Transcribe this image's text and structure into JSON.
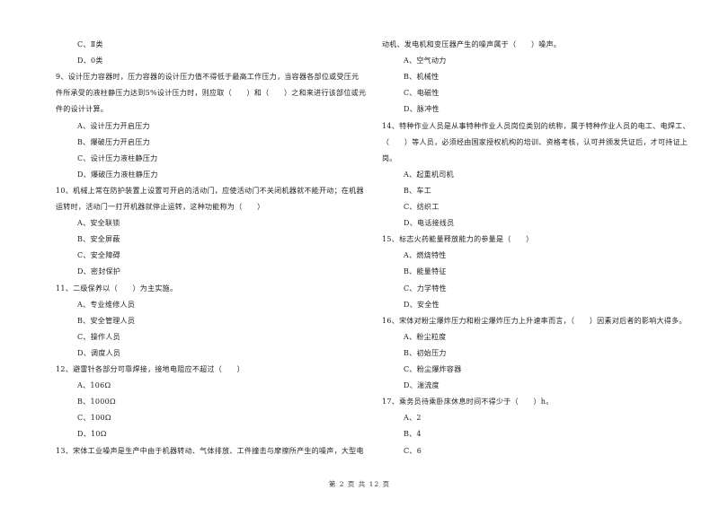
{
  "left_column": {
    "lines": [
      {
        "kind": "option",
        "text": "C、Ⅱ类"
      },
      {
        "kind": "option",
        "text": "D、0类"
      },
      {
        "kind": "question",
        "text": "9、设计压力容器时，压力容器的设计压力值不得低于最高工作压力，当容器各部位或受压元"
      },
      {
        "kind": "question",
        "text": "件所承受的液柱静压力达到5%设计压力时，则应取（　　）和（　　）之和来进行该部位或元"
      },
      {
        "kind": "question",
        "text": "件的设计计算。"
      },
      {
        "kind": "option",
        "text": "A、设计压力开启压力"
      },
      {
        "kind": "option",
        "text": "B、爆破压力开启压力"
      },
      {
        "kind": "option",
        "text": "C、设计压力液柱静压力"
      },
      {
        "kind": "option",
        "text": "D、爆破压力液柱静压力"
      },
      {
        "kind": "question",
        "text": "10、机械上常在防护装置上设置可开启的活动门，应使活动门不关闭机器就不能开动；在机器"
      },
      {
        "kind": "question",
        "text": "运转时，活动门一打开机器就停止运转，这种功能称为（　　）"
      },
      {
        "kind": "option",
        "text": "A、安全联锁"
      },
      {
        "kind": "option",
        "text": "B、安全屏蔽"
      },
      {
        "kind": "option",
        "text": "C、安全障碍"
      },
      {
        "kind": "option",
        "text": "D、密封保护"
      },
      {
        "kind": "question",
        "text": "11、二级保养以（　　）为主实施。"
      },
      {
        "kind": "option",
        "text": "A、专业维修人员"
      },
      {
        "kind": "option",
        "text": "B、安全管理人员"
      },
      {
        "kind": "option",
        "text": "C、操作人员"
      },
      {
        "kind": "option",
        "text": "D、调度人员"
      },
      {
        "kind": "question",
        "text": "12、避雷针各部分可靠焊接，接地电阻应不超过（　　）"
      },
      {
        "kind": "option",
        "text": "A、106Ω"
      },
      {
        "kind": "option",
        "text": "B、1000Ω"
      },
      {
        "kind": "option",
        "text": "C、100Ω"
      },
      {
        "kind": "option",
        "text": "D、10Ω"
      },
      {
        "kind": "question",
        "text": "13、宋体工业噪声是生产中由于机器转动、气体排放、工件撞击与摩擦所产生的噪声，大型电"
      }
    ]
  },
  "right_column": {
    "lines": [
      {
        "kind": "question",
        "text": "动机、发电机和变压器产生的噪声属于（　　）噪声。"
      },
      {
        "kind": "option",
        "text": "A、空气动力"
      },
      {
        "kind": "option",
        "text": "B、机械性"
      },
      {
        "kind": "option",
        "text": "C、电磁性"
      },
      {
        "kind": "option",
        "text": "D、脉冲性"
      },
      {
        "kind": "question",
        "text": "14、特种作业人员是从事特种作业人员岗位类别的统称，属于特种作业人员的电工、电焊工、"
      },
      {
        "kind": "question",
        "text": "（　　）等人员，必须经由国家授权机构的培训、资格考核，认可并颁发凭证后，才可持证上"
      },
      {
        "kind": "question",
        "text": "岗。"
      },
      {
        "kind": "option",
        "text": "A、起重机司机"
      },
      {
        "kind": "option",
        "text": "B、车工"
      },
      {
        "kind": "option",
        "text": "C、纺织工"
      },
      {
        "kind": "option",
        "text": "D、电话接线员"
      },
      {
        "kind": "question",
        "text": "15、标志火药能量释放能力的参量是（　　）"
      },
      {
        "kind": "option",
        "text": "A、燃烧特性"
      },
      {
        "kind": "option",
        "text": "B、能量特征"
      },
      {
        "kind": "option",
        "text": "C、力学特性"
      },
      {
        "kind": "option",
        "text": "D、安全性"
      },
      {
        "kind": "question",
        "text": "16、宋体对粉尘爆炸压力和粉尘爆炸压力上升速率而言，（　　）因素对后者的影响大得多。"
      },
      {
        "kind": "option",
        "text": "A、粉尘粒度"
      },
      {
        "kind": "option",
        "text": "B、初始压力"
      },
      {
        "kind": "option",
        "text": "C、粉尘爆炸容器"
      },
      {
        "kind": "option",
        "text": "D、湍流度"
      },
      {
        "kind": "question",
        "text": "17、乘务员待乘卧床休息时间不得少于（　　）h。"
      },
      {
        "kind": "option",
        "text": "A、2"
      },
      {
        "kind": "option",
        "text": "B、4"
      },
      {
        "kind": "option",
        "text": "C、6"
      }
    ]
  },
  "footer": {
    "page_label": "第 2 页 共 12 页"
  }
}
